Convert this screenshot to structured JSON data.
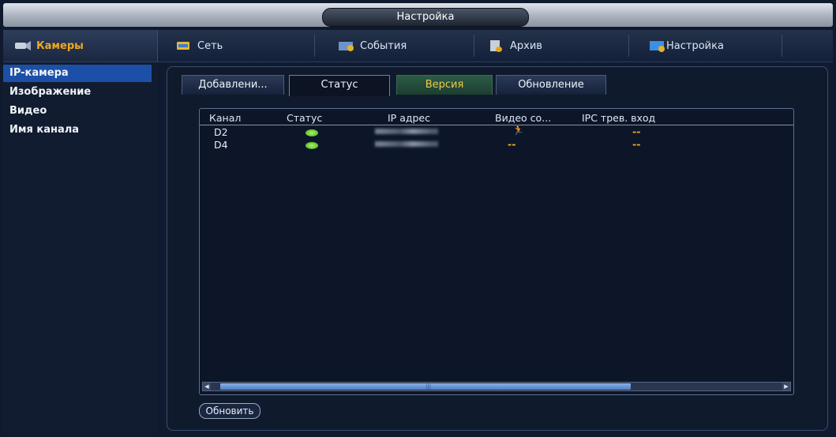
{
  "window": {
    "title": "Настройка"
  },
  "topmenu": {
    "items": [
      {
        "label": "Камеры",
        "icon": "camera-icon",
        "active": true
      },
      {
        "label": "Сеть",
        "icon": "network-icon"
      },
      {
        "label": "События",
        "icon": "events-icon"
      },
      {
        "label": "Архив",
        "icon": "archive-icon"
      },
      {
        "label": "Настройка",
        "icon": "settings-icon"
      }
    ]
  },
  "sidebar": {
    "items": [
      {
        "label": "IP-камера",
        "active": true
      },
      {
        "label": "Изображение"
      },
      {
        "label": "Видео"
      },
      {
        "label": "Имя канала"
      }
    ]
  },
  "tabs": [
    {
      "label": "Добавлени..."
    },
    {
      "label": "Статус",
      "active": true
    },
    {
      "label": "Версия"
    },
    {
      "label": "Обновление"
    }
  ],
  "table": {
    "columns": [
      "Канал",
      "Статус",
      "IP адрес",
      "Видео со...",
      "IPC трев. вход"
    ],
    "rows": [
      {
        "channel": "D2",
        "status": "online",
        "ip": "",
        "video": "motion-icon",
        "alarm": "--"
      },
      {
        "channel": "D4",
        "status": "online",
        "ip": "",
        "video": "--",
        "alarm": "--"
      }
    ]
  },
  "buttons": {
    "refresh": "Обновить"
  },
  "colors": {
    "accent": "#f0a820",
    "active_sidebar": "#1c50a8",
    "status_online": "#5cc924",
    "highlight_tab_text": "#f2c94c"
  }
}
